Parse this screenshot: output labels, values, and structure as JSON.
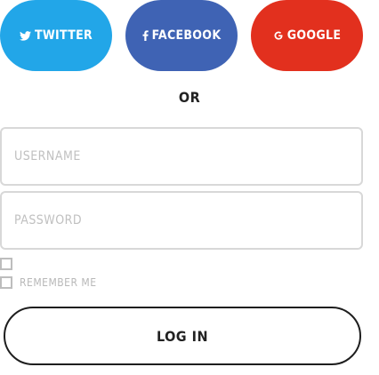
{
  "social": {
    "twitter": {
      "label": "TWITTER",
      "icon": "twitter-icon",
      "color": "#22a6e8"
    },
    "facebook": {
      "label": "FACEBOOK",
      "icon": "facebook-icon",
      "color": "#3f63b4"
    },
    "google": {
      "label": "GOOGLE",
      "icon": "google-icon",
      "color": "#e2301e"
    }
  },
  "divider_label": "OR",
  "form": {
    "username": {
      "placeholder": "USERNAME",
      "value": ""
    },
    "password": {
      "placeholder": "PASSWORD",
      "value": ""
    },
    "remember_label": "REMEMBER ME",
    "remember_checked": false,
    "extra_checkbox_checked": false
  },
  "login_label": "LOG IN"
}
